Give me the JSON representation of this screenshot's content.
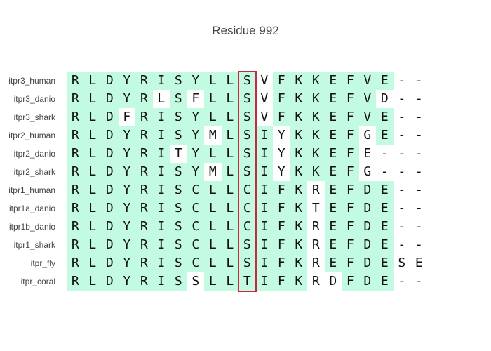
{
  "title": "Residue 992",
  "colors": {
    "match": "#c2fbe2",
    "mismatch": "#ffffff",
    "highlight": "#c8283c"
  },
  "highlight_column_index": 10,
  "alignment": [
    {
      "name": "itpr3_human",
      "seq": "RLDYRISYLLSVFKKEFVE--",
      "mismatch": [
        11,
        19,
        20
      ]
    },
    {
      "name": "itpr3_danio",
      "seq": "RLDYRLSFLLSVFKKEFVD--",
      "mismatch": [
        5,
        7,
        11,
        18,
        19,
        20
      ]
    },
    {
      "name": "itpr3_shark",
      "seq": "RLDFRISYLLSVFKKEFVE--",
      "mismatch": [
        3,
        11,
        19,
        20
      ]
    },
    {
      "name": "itpr2_human",
      "seq": "RLDYRISYMLSIYKKEFGE--",
      "mismatch": [
        8,
        12,
        17,
        19,
        20
      ]
    },
    {
      "name": "itpr2_danio",
      "seq": "RLDYRITYLLSIYKKEFE---",
      "mismatch": [
        6,
        12,
        17,
        18,
        19,
        20
      ]
    },
    {
      "name": "itpr2_shark",
      "seq": "RLDYRISYMLSIYKKEFG---",
      "mismatch": [
        8,
        12,
        17,
        18,
        19,
        20
      ]
    },
    {
      "name": "itpr1_human",
      "seq": "RLDYRISCLLCIFKREFDE--",
      "mismatch": [
        14,
        19,
        20
      ]
    },
    {
      "name": "itpr1a_danio",
      "seq": "RLDYRISCLLCIFKTEFDE--",
      "mismatch": [
        14,
        19,
        20
      ]
    },
    {
      "name": "itpr1b_danio",
      "seq": "RLDYRISCLLCIFKREFDE--",
      "mismatch": [
        14,
        19,
        20
      ]
    },
    {
      "name": "itpr1_shark",
      "seq": "RLDYRISCLLSIFKREFDE--",
      "mismatch": [
        14,
        19,
        20
      ]
    },
    {
      "name": "itpr_fly",
      "seq": "RLDYRISCLLSIFKREFDESE",
      "mismatch": [
        14,
        19,
        20
      ]
    },
    {
      "name": "itpr_coral",
      "seq": "RLDYRISSLLTIFKRDFDE--",
      "mismatch": [
        7,
        14,
        15,
        19,
        20
      ]
    }
  ]
}
